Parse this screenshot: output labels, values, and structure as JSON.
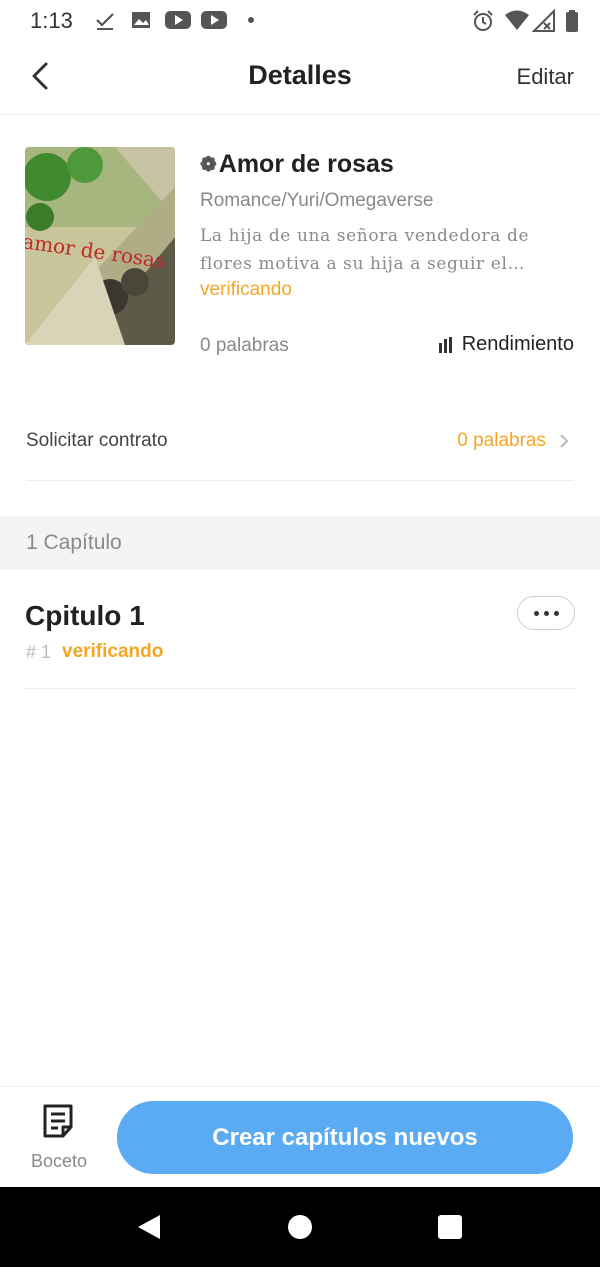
{
  "status_bar": {
    "time": "1:13",
    "icons": [
      "check-download-icon",
      "image-icon",
      "youtube-icon",
      "youtube-icon",
      "dot-icon",
      "alarm-icon",
      "wifi-icon",
      "signal-icon",
      "battery-icon"
    ]
  },
  "header": {
    "title": "Detalles",
    "edit_label": "Editar",
    "back_icon": "back-arrow-icon"
  },
  "book": {
    "title": "Amor de rosas",
    "title_prefix_icon": "flower-icon",
    "genres": "Romance/Yuri/Omegaverse",
    "synopsis_line1": "La hija de una señora vendedora de",
    "synopsis_line2": "flores motiva a su hija a seguir el…",
    "status": "verificando",
    "words": "0 palabras",
    "performance_label": "Rendimiento"
  },
  "contract": {
    "label": "Solicitar contrato",
    "value": "0 palabras"
  },
  "chapters": {
    "count_label": "1 Capítulo",
    "items": [
      {
        "title": "Cpitulo 1",
        "number": "# 1",
        "status": "verificando"
      }
    ]
  },
  "bottom_bar": {
    "draft_label": "Boceto",
    "create_label": "Crear capítulos nuevos"
  },
  "colors": {
    "accent_orange": "#f5a623",
    "primary_blue": "#5aaaf4",
    "muted_gray": "#8a8a8a"
  }
}
